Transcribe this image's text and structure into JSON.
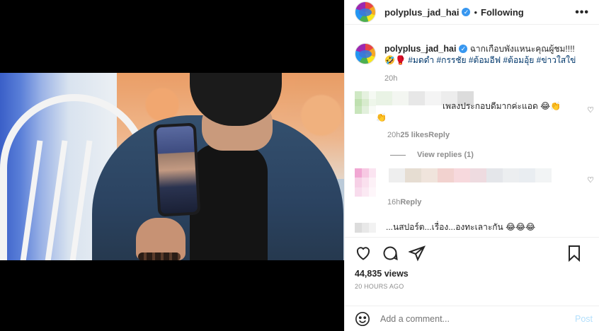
{
  "post": {
    "username": "polyplus_jad_hai",
    "verified_glyph": "✓",
    "dot": "•",
    "follow_state": "Following",
    "more_glyph": "•••"
  },
  "caption": {
    "username": "polyplus_jad_hai",
    "text": " ฉากเกือบพังแหนะคุณผู้ชม!!!!",
    "emojis": "🤣🥊",
    "hashtags": [
      "#มดดำ",
      "#กรรชัย",
      "#ต้อมอีฟ",
      "#ต้อมอุ้ย",
      "#ข่าวใสใข่"
    ],
    "time": "20h"
  },
  "comments": [
    {
      "text": "เพลงประกอบดีมากค่ะแอด 😂👏",
      "emoji_line": "👏",
      "time": "20h",
      "likes": "25 likes",
      "reply": "Reply",
      "view_replies": "View replies (1)",
      "avatar_colors": [
        "#cfe8c4",
        "#e5f1df",
        "#f5f9f3",
        "#bfe0b0",
        "#d7ebcd",
        "#eef6ea",
        "#c8e5bb",
        "#e2f0dc",
        "#f8fbf6"
      ],
      "name_colors": [
        "#e9f3e5",
        "#f3f6f1",
        "#e7e7e7",
        "#f4f4f4",
        "#ededed",
        "#dcdcdc"
      ]
    },
    {
      "text": "",
      "time": "16h",
      "reply": "Reply",
      "avatar_colors": [
        "#f1a7d3",
        "#f7c9e3",
        "#fbe4f1",
        "#f6d0e6",
        "#fae0ee",
        "#fdf1f7",
        "#f8dced",
        "#fbe9f3",
        "#fef6fa"
      ],
      "name_colors": [
        "#eeeeee",
        "#e6ddd2",
        "#f0e4dc",
        "#f2d2cf",
        "#f7d9dd",
        "#eedbe0",
        "#e4e6ea",
        "#eceef0",
        "#e9edf1",
        "#f2f4f5"
      ]
    },
    {
      "text": "...นสปอร์ต...เรื่อง...องทะเลาะกัน 😂😂😂",
      "avatar_colors": [
        "#dcdcdc",
        "#e8e8e8",
        "#f2f2f2"
      ]
    }
  ],
  "actions": {
    "views": "44,835 views",
    "time_ago": "20 HOURS AGO",
    "icons": [
      "heart-icon",
      "comment-icon",
      "share-icon",
      "bookmark-icon"
    ]
  },
  "add_comment": {
    "placeholder": "Add a comment...",
    "post_label": "Post",
    "emoji_icon": "emoji-icon"
  }
}
